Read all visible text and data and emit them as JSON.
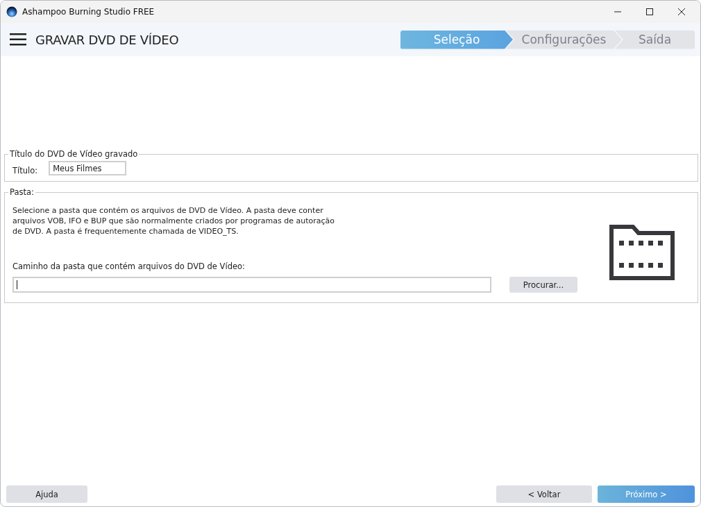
{
  "window": {
    "title": "Ashampoo Burning Studio FREE"
  },
  "header": {
    "title": "GRAVAR DVD DE VÍDEO"
  },
  "steps": [
    {
      "label": "Seleção",
      "selected": true
    },
    {
      "label": "Configurações",
      "selected": false
    },
    {
      "label": "Saída",
      "selected": false
    }
  ],
  "title_group": {
    "legend": "Título do DVD de Vídeo gravado",
    "label": "Título:",
    "value": "Meus Filmes"
  },
  "folder_group": {
    "legend": "Pasta:",
    "description": "Selecione a pasta que contém os arquivos de DVD de Vídeo. A pasta deve conter arquivos VOB, IFO e BUP que são normalmente criados por programas de autoração de DVD. A pasta é frequentemente chamada de VIDEO_TS.",
    "path_label": "Caminho da pasta que contém arquivos do DVD de Vídeo:",
    "path_focused": true,
    "browse_button": "Procurar..."
  },
  "buttons": [
    {
      "label": "Ajuda",
      "kind": "secondary"
    },
    {
      "label": "< Voltar",
      "kind": "secondary"
    },
    {
      "label": "Próximo >",
      "kind": "primary"
    }
  ]
}
